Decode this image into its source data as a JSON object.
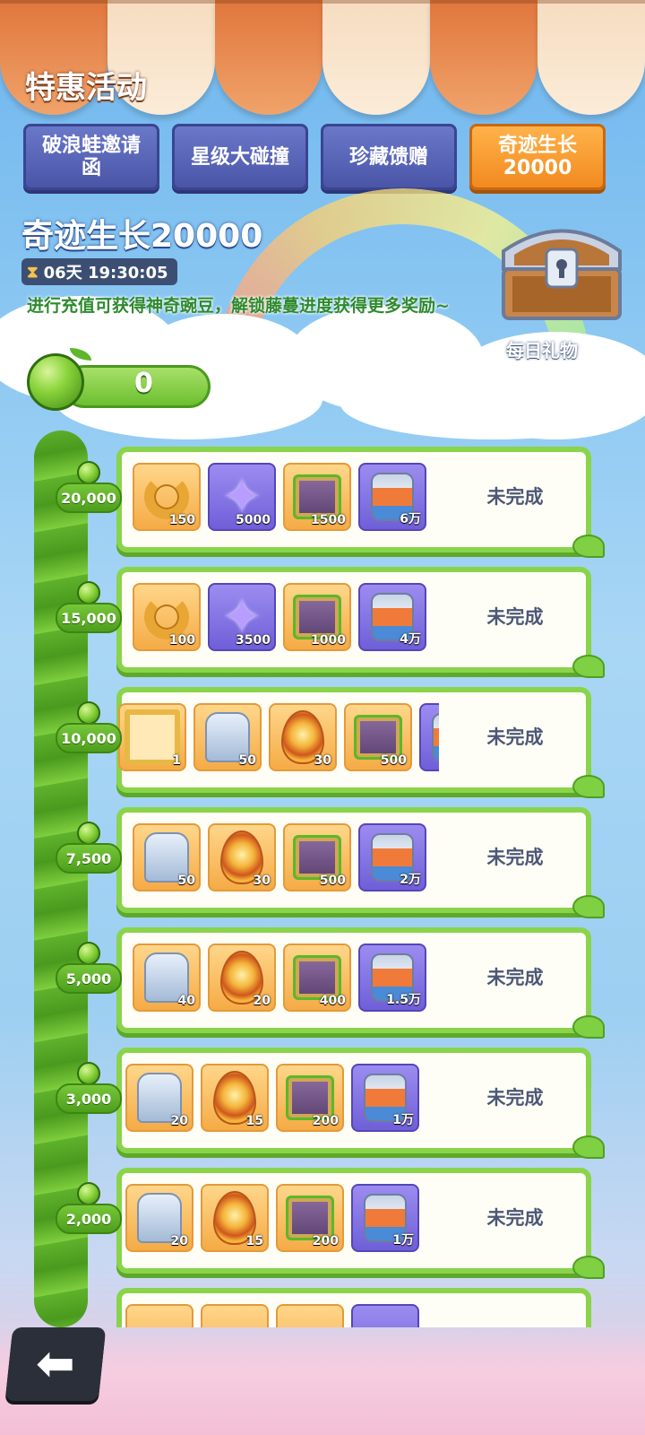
{
  "header": {
    "title": "特惠活动"
  },
  "tabs": [
    {
      "label": "破浪蛙邀请函",
      "active": false
    },
    {
      "label": "星级大碰撞",
      "active": false
    },
    {
      "label": "珍藏馈赠",
      "active": false
    },
    {
      "label": "奇迹生长 20000",
      "active": true
    }
  ],
  "event": {
    "heading": "奇迹生长20000",
    "countdown": "06天 19:30:05",
    "description": "进行充值可获得神奇豌豆，解锁藤蔓进度获得更多奖励~",
    "daily_gift_label": "每日礼物",
    "pea_count": "0"
  },
  "milestones": [
    {
      "threshold": "20,000",
      "status": "未完成",
      "rewards": [
        {
          "icon": "horseshoe-icon",
          "qty": "150"
        },
        {
          "icon": "star-crystal-icon",
          "qty": "5000"
        },
        {
          "icon": "vine-box-icon",
          "qty": "1500"
        },
        {
          "icon": "food-can-icon",
          "qty": "6万"
        }
      ]
    },
    {
      "threshold": "15,000",
      "status": "未完成",
      "rewards": [
        {
          "icon": "horseshoe-icon",
          "qty": "100"
        },
        {
          "icon": "star-crystal-icon",
          "qty": "3500"
        },
        {
          "icon": "vine-box-icon",
          "qty": "1000"
        },
        {
          "icon": "food-can-icon",
          "qty": "4万"
        }
      ]
    },
    {
      "threshold": "10,000",
      "status": "未完成",
      "rewards": [
        {
          "icon": "avatar-frame-icon",
          "qty": "1"
        },
        {
          "icon": "puzzle-piece-icon",
          "qty": "50"
        },
        {
          "icon": "golden-egg-icon",
          "qty": "30"
        },
        {
          "icon": "vine-box-icon",
          "qty": "500"
        },
        {
          "icon": "food-can-icon",
          "qty": ""
        }
      ]
    },
    {
      "threshold": "7,500",
      "status": "未完成",
      "rewards": [
        {
          "icon": "puzzle-piece-icon",
          "qty": "50"
        },
        {
          "icon": "golden-egg-icon",
          "qty": "30"
        },
        {
          "icon": "vine-box-icon",
          "qty": "500"
        },
        {
          "icon": "food-can-icon",
          "qty": "2万"
        }
      ]
    },
    {
      "threshold": "5,000",
      "status": "未完成",
      "rewards": [
        {
          "icon": "puzzle-piece-icon",
          "qty": "40"
        },
        {
          "icon": "golden-egg-icon",
          "qty": "20"
        },
        {
          "icon": "vine-box-icon",
          "qty": "400"
        },
        {
          "icon": "food-can-icon",
          "qty": "1.5万"
        }
      ]
    },
    {
      "threshold": "3,000",
      "status": "未完成",
      "rewards": [
        {
          "icon": "puzzle-piece-icon",
          "qty": "20"
        },
        {
          "icon": "golden-egg-icon",
          "qty": "15"
        },
        {
          "icon": "vine-box-icon",
          "qty": "200"
        },
        {
          "icon": "food-can-icon",
          "qty": "1万"
        }
      ]
    },
    {
      "threshold": "2,000",
      "status": "未完成",
      "rewards": [
        {
          "icon": "puzzle-piece-icon",
          "qty": "20"
        },
        {
          "icon": "golden-egg-icon",
          "qty": "15"
        },
        {
          "icon": "vine-box-icon",
          "qty": "200"
        },
        {
          "icon": "food-can-icon",
          "qty": "1万"
        }
      ]
    }
  ],
  "back_button": {
    "icon": "back-arrow-icon"
  }
}
